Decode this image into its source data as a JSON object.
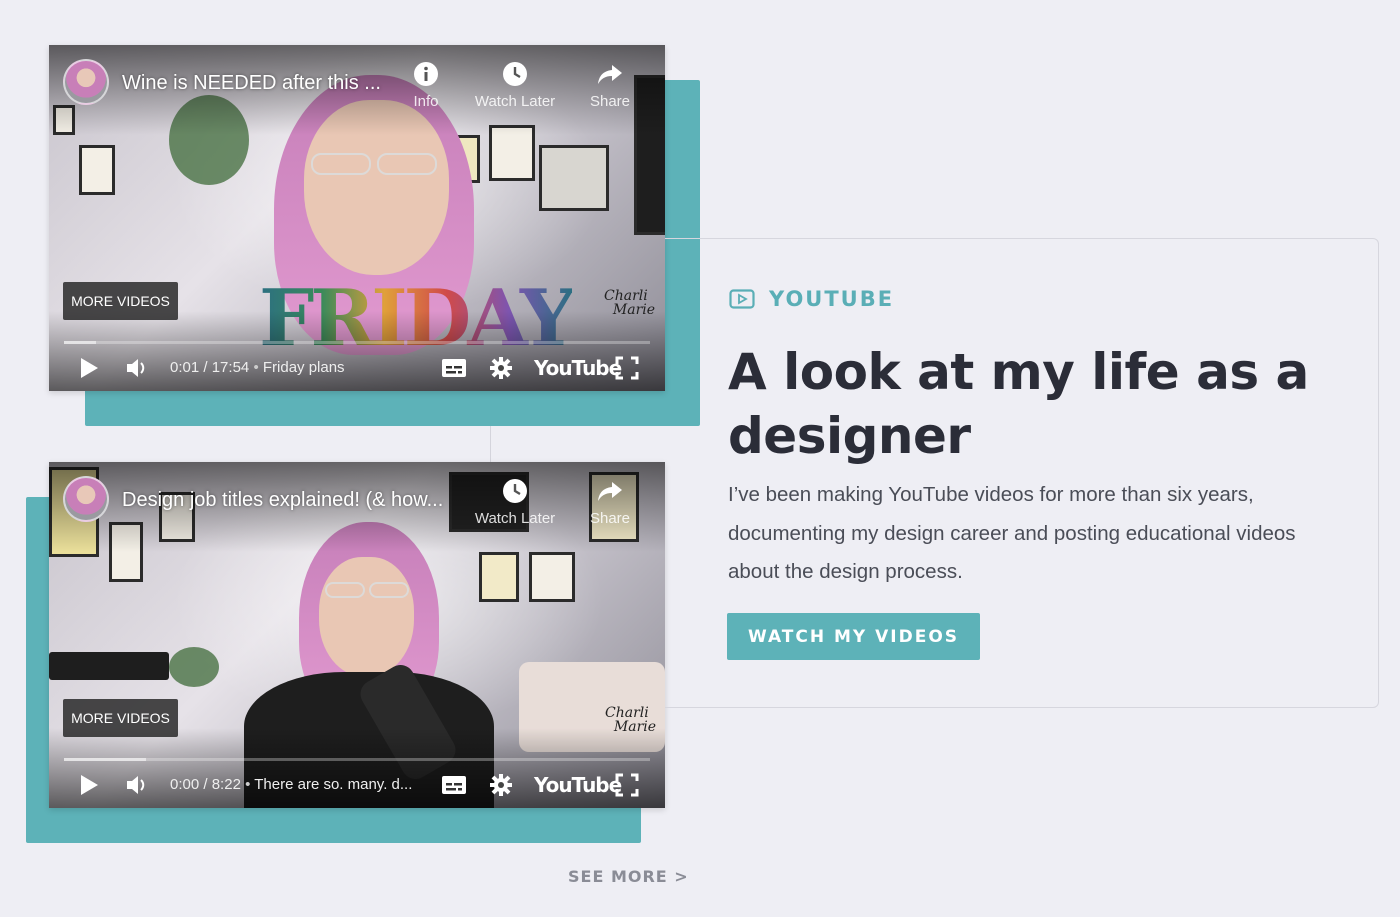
{
  "section": {
    "label": "YOUTUBE",
    "heading": "A look at my life as a designer",
    "description": "I’ve been making YouTube videos for more than six years, documenting my design career and posting educational videos about the design process.",
    "cta_label": "WATCH MY VIDEOS",
    "see_more_label": "SEE MORE >",
    "accent_color": "#5db2b8",
    "label_icon": "play-square-icon"
  },
  "videos": [
    {
      "title": "Wine is NEEDED after this ...",
      "actions": [
        {
          "icon": "info-icon",
          "label": "Info"
        },
        {
          "icon": "clock-icon",
          "label": "Watch Later"
        },
        {
          "icon": "share-icon",
          "label": "Share"
        }
      ],
      "more_videos_label": "MORE VIDEOS",
      "time_current": "0:01",
      "time_total": "17:54",
      "chapter": "Friday plans",
      "brand": "YouTube",
      "overlay_text": "FRIDAY",
      "signature": "Charli Marie"
    },
    {
      "title": "Design job titles explained! (& how...",
      "actions": [
        {
          "icon": "clock-icon",
          "label": "Watch Later"
        },
        {
          "icon": "share-icon",
          "label": "Share"
        }
      ],
      "more_videos_label": "MORE VIDEOS",
      "time_current": "0:00",
      "time_total": "8:22",
      "chapter": "There are so. many. d...",
      "brand": "YouTube",
      "signature": "Charli Marie"
    }
  ]
}
